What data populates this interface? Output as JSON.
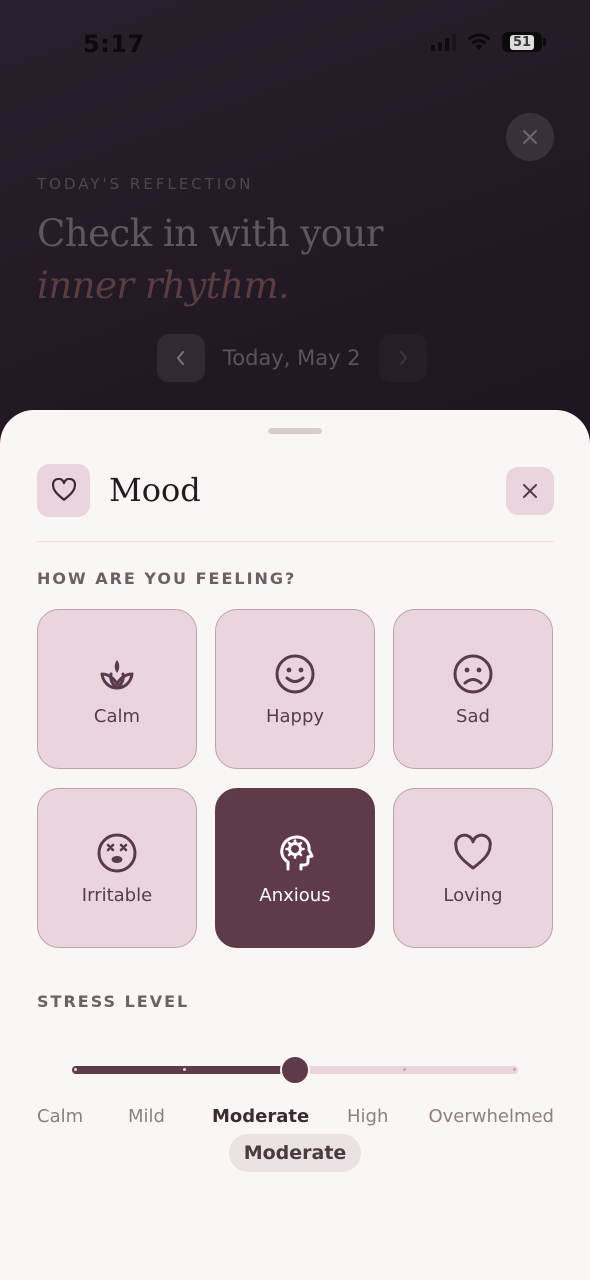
{
  "status_bar": {
    "time": "5:17",
    "battery": "51"
  },
  "background": {
    "eyebrow": "TODAY'S REFLECTION",
    "headline_line1": "Check in with your",
    "headline_line2": "inner rhythm.",
    "date_label": "Today, May 2"
  },
  "sheet": {
    "title": "Mood",
    "mood_question": "HOW ARE YOU FEELING?",
    "moods": [
      {
        "label": "Calm",
        "icon": "lotus-icon",
        "selected": false
      },
      {
        "label": "Happy",
        "icon": "smile-icon",
        "selected": false
      },
      {
        "label": "Sad",
        "icon": "frown-icon",
        "selected": false
      },
      {
        "label": "Irritable",
        "icon": "dizzy-face-icon",
        "selected": false
      },
      {
        "label": "Anxious",
        "icon": "head-gear-icon",
        "selected": true
      },
      {
        "label": "Loving",
        "icon": "heart-icon",
        "selected": false
      }
    ],
    "stress_label": "STRESS LEVEL",
    "stress_scale": [
      "Calm",
      "Mild",
      "Moderate",
      "High",
      "Overwhelmed"
    ],
    "stress_value_index": 2,
    "stress_value": "Moderate"
  },
  "colors": {
    "accent": "#5e3a4a",
    "tile_bg": "#ead5df",
    "sheet_bg": "#faf6f3"
  }
}
